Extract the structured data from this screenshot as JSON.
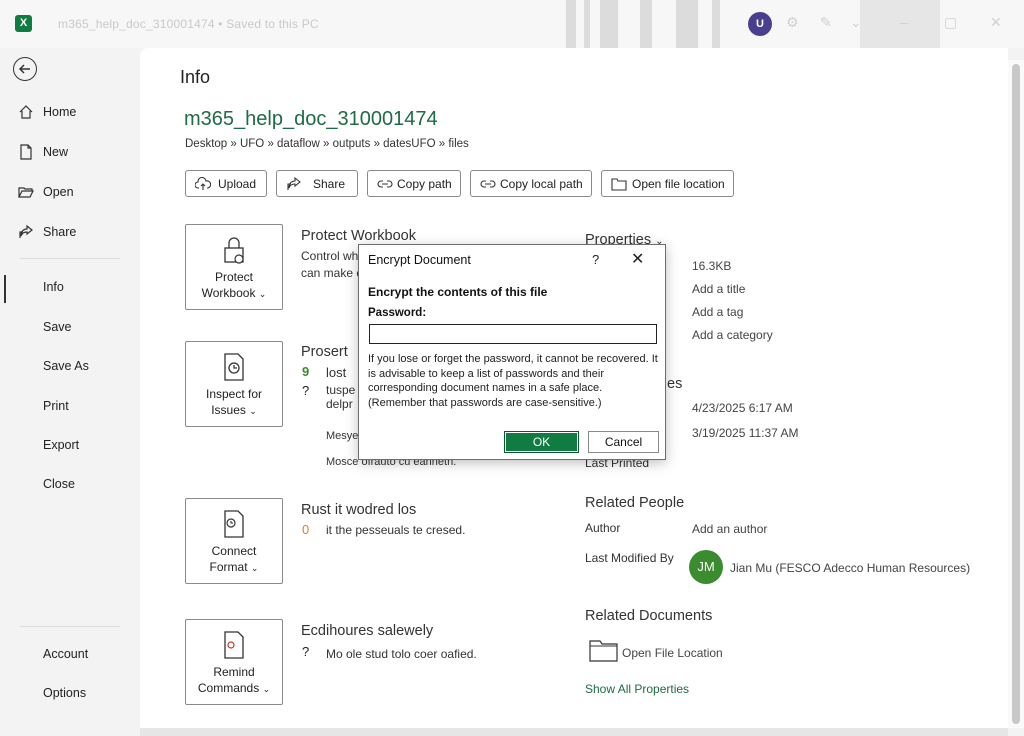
{
  "window": {
    "title": "m365_help_doc_310001474 • Saved to this PC",
    "user_initial": "U"
  },
  "sidebar": {
    "items": [
      {
        "label": "Home"
      },
      {
        "label": "New"
      },
      {
        "label": "Open"
      },
      {
        "label": "Share"
      },
      {
        "label": "Info"
      },
      {
        "label": "Save"
      },
      {
        "label": "Save As"
      },
      {
        "label": "Print"
      },
      {
        "label": "Export"
      },
      {
        "label": "Close"
      }
    ],
    "footer": [
      {
        "label": "Account"
      },
      {
        "label": "Options"
      }
    ]
  },
  "main": {
    "title": "Info",
    "doc_name": "m365_help_doc_310001474",
    "breadcrumb": "Desktop » UFO » dataflow » outputs » datesUFO » files",
    "toolbar": {
      "upload": "Upload",
      "share": "Share",
      "copy_path": "Copy path",
      "copy_local_path": "Copy local path",
      "open_location": "Open file location"
    },
    "sections": {
      "protect": {
        "button_line1": "Protect",
        "button_line2": "Workbook",
        "title": "Protect Workbook",
        "line1": "Control wh",
        "line2": "can make c"
      },
      "inspect": {
        "button_line1": "Inspect for",
        "button_line2": "Issues",
        "title": "Prosert",
        "line1": "lost",
        "line2": "tuspe",
        "line3": "delpr",
        "line4": "Mesye",
        "line5": "Mosce ofrauto cu eannetn."
      },
      "manage": {
        "button_line1": "Connect",
        "button_line2": "Format",
        "title": "Rust it wodred los",
        "line1": "it the pesseuals te cresed."
      },
      "browser": {
        "button_line1": "Remind",
        "button_line2": "Commands",
        "title": "Ecdihoures salewely",
        "line1": "Mo ole stud tolo coer oafied."
      }
    }
  },
  "properties": {
    "header": "Properties",
    "size": "16.3KB",
    "title": "Add a title",
    "tags": "Add a tag",
    "categories": "Add a category",
    "dates_header": "es",
    "last_modified": "4/23/2025 6:17 AM",
    "created": "3/19/2025 11:37 AM",
    "last_printed_key": "Last Printed",
    "related_people": "Related People",
    "author_key": "Author",
    "author_val": "Add an author",
    "modified_by_key": "Last Modified By",
    "modified_by_initials": "JM",
    "modified_by_name": "Jian Mu (FESCO Adecco Human Resources)",
    "related_docs": "Related Documents",
    "open_file_location": "Open File Location",
    "show_all": "Show All Properties"
  },
  "dialog": {
    "title": "Encrypt Document",
    "help": "?",
    "heading": "Encrypt the contents of this file",
    "password_label": "Password:",
    "password_value": "",
    "note": "If you lose or forget the password, it cannot be recovered. It is advisable to keep a list of passwords and their corresponding document names in a safe place. (Remember that passwords are case-sensitive.)",
    "ok": "OK",
    "cancel": "Cancel"
  },
  "colors": {
    "accent": "#107c41",
    "doc_name": "#1e6b45",
    "avatar_u": "#4a3f8e",
    "avatar_jm": "#3b8b2f"
  },
  "icons": {
    "back": "back-arrow-icon",
    "home": "home-icon",
    "new": "new-doc-icon",
    "open": "folder-open-icon",
    "share": "share-icon",
    "upload": "cloud-upload-icon",
    "copy": "link-icon",
    "folder": "folder-icon",
    "lock": "lock-icon",
    "inspect": "inspect-doc-icon"
  }
}
